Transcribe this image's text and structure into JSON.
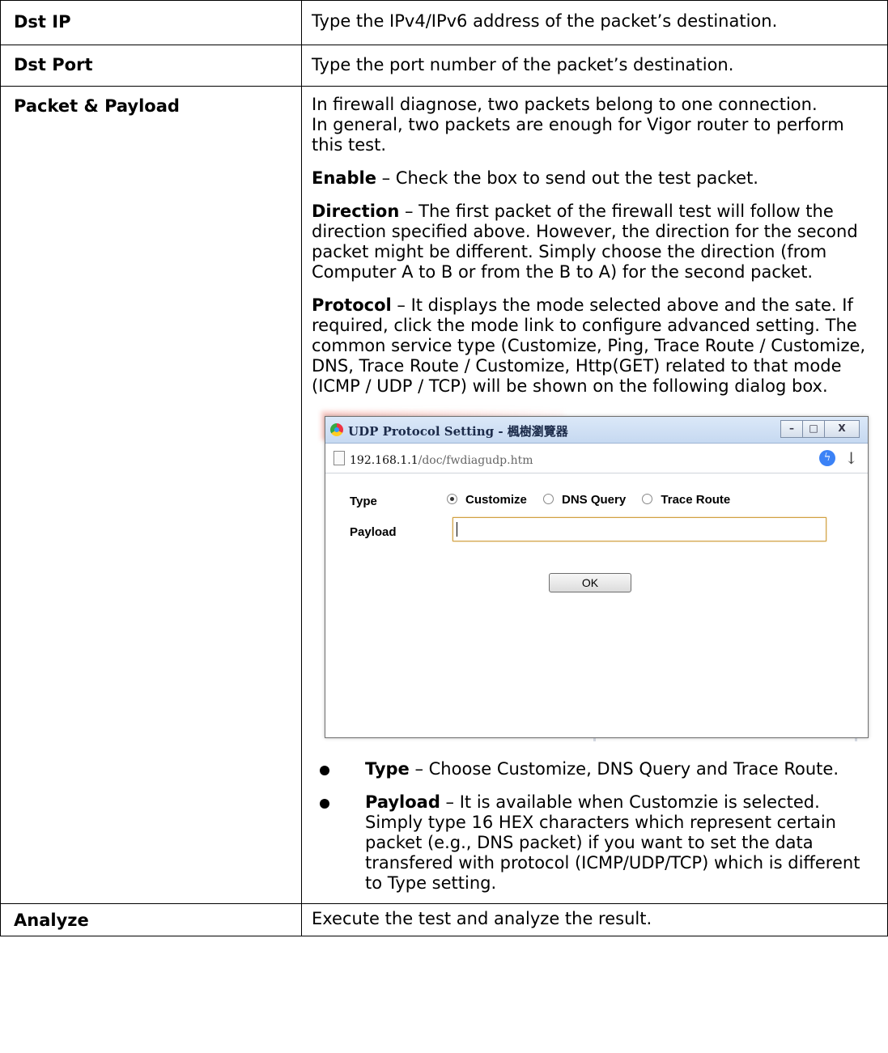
{
  "rows": {
    "dst_ip": {
      "term": "Dst IP",
      "desc": "Type the IPv4/IPv6 address of the packet’s destination."
    },
    "dst_port": {
      "term": "Dst Port",
      "desc": "Type the port number of the packet’s destination."
    },
    "packet": {
      "term": "Packet & Payload",
      "intro1": "In firewall diagnose, two packets belong to one connection.",
      "intro2": "In general, two packets are enough for Vigor router to perform this test.",
      "enable_label": "Enable",
      "enable_text": " – Check the box to send out the test packet.",
      "direction_label": "Direction",
      "direction_text": " – The first packet of the firewall test will follow the direction specified above. However, the direction for the second packet might be different. Simply choose the direction (from Computer A to B or from the B to A) for the second packet.",
      "protocol_label": "Protocol",
      "protocol_text": " – It displays the mode selected above and the sate. If required, click the mode link to configure advanced setting. The common service type (Customize, Ping, Trace Route / Customize, DNS, Trace Route / Customize, Http(GET) related to that mode (ICMP / UDP / TCP) will be shown on the following dialog box.",
      "bullets": [
        {
          "label": "Type",
          "text": " – Choose Customize, DNS Query and Trace Route."
        },
        {
          "label": "Payload",
          "text": " – It is available when Customzie is selected. Simply type 16 HEX characters which represent certain packet (e.g., DNS packet) if you want to set the data transfered with protocol (ICMP/UDP/TCP) which is different to Type setting."
        }
      ]
    },
    "analyze": {
      "term": "Analyze",
      "desc": "Execute the test and analyze the result."
    }
  },
  "dialog": {
    "title": "UDP Protocol Setting - 楓樹瀏覽器",
    "url_host": "192.168.1.1",
    "url_path": "/doc/fwdiagudp.htm",
    "type_label": "Type",
    "payload_label": "Payload",
    "options": [
      "Customize",
      "DNS Query",
      "Trace Route"
    ],
    "selected_option": "Customize",
    "ok_label": "OK",
    "btn_min": "–",
    "btn_max": "□",
    "btn_close": "X"
  }
}
